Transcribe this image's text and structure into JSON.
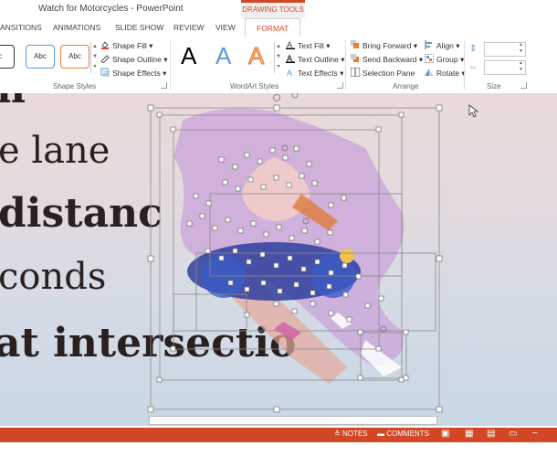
{
  "window": {
    "title": "Watch for Motorcycles - PowerPoint",
    "context_tab_label": "DRAWING TOOLS"
  },
  "tabs": [
    {
      "label": "ANSITIONS"
    },
    {
      "label": "ANIMATIONS"
    },
    {
      "label": "SLIDE SHOW"
    },
    {
      "label": "REVIEW"
    },
    {
      "label": "VIEW"
    },
    {
      "label": "FORMAT",
      "active": true
    }
  ],
  "ribbon": {
    "shape_styles": {
      "group_label": "Shape Styles",
      "presets": [
        "c",
        "Abc",
        "Abc"
      ],
      "shape_fill": "Shape Fill",
      "shape_outline": "Shape Outline",
      "shape_effects": "Shape Effects"
    },
    "wordart_styles": {
      "group_label": "WordArt Styles",
      "samples": [
        "A",
        "A",
        "A"
      ],
      "text_fill": "Text Fill",
      "text_outline": "Text Outline",
      "text_effects": "Text Effects"
    },
    "arrange": {
      "group_label": "Arrange",
      "bring_forward": "Bring Forward",
      "send_backward": "Send Backward",
      "selection_pane": "Selection Pane",
      "align": "Align",
      "group": "Group",
      "rotate": "Rotate"
    },
    "size": {
      "group_label": "Size",
      "height_value": "",
      "width_value": ""
    }
  },
  "slide": {
    "lines": [
      "h",
      "e lane",
      "distanc",
      "conds",
      "at intersectio"
    ]
  },
  "statusbar": {
    "notes": "NOTES",
    "comments": "COMMENTS"
  },
  "colors": {
    "accent": "#d24726",
    "wordart_black": "#000000",
    "wordart_blue": "#5b9bd5",
    "wordart_orange": "#ed7d31"
  }
}
